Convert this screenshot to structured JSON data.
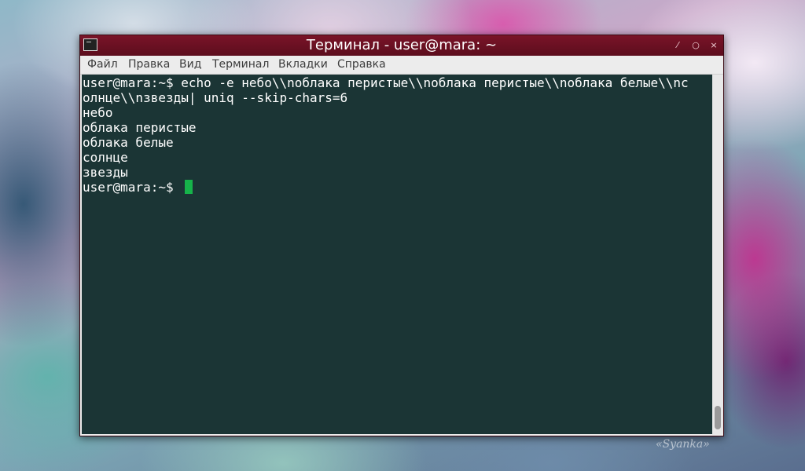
{
  "window": {
    "title": "Терминал - user@mara: ~",
    "minimize_glyph": "⁄",
    "maximize_glyph": "○",
    "close_glyph": "×"
  },
  "menu": {
    "items": [
      {
        "label": "Файл"
      },
      {
        "label": "Правка"
      },
      {
        "label": "Вид"
      },
      {
        "label": "Терминал"
      },
      {
        "label": "Вкладки"
      },
      {
        "label": "Справка"
      }
    ]
  },
  "terminal": {
    "lines": [
      "user@mara:~$ echo -e небо\\\\nоблака перистые\\\\nоблака перистые\\\\nоблака белые\\\\nс",
      "олнце\\\\nзвезды| uniq --skip-chars=6",
      "небо",
      "облака перистые",
      "облака белые",
      "солнце",
      "звезды",
      "user@mara:~$ "
    ]
  },
  "icons": {
    "app": "terminal-icon",
    "minimize": "minimize-icon",
    "maximize": "maximize-icon",
    "close": "close-icon"
  },
  "colors": {
    "titlebar": "#6b1122",
    "terminal_bg": "#1b3535",
    "terminal_fg": "#ffffff",
    "cursor": "#16b34a"
  },
  "watermark": "«Syanka»"
}
